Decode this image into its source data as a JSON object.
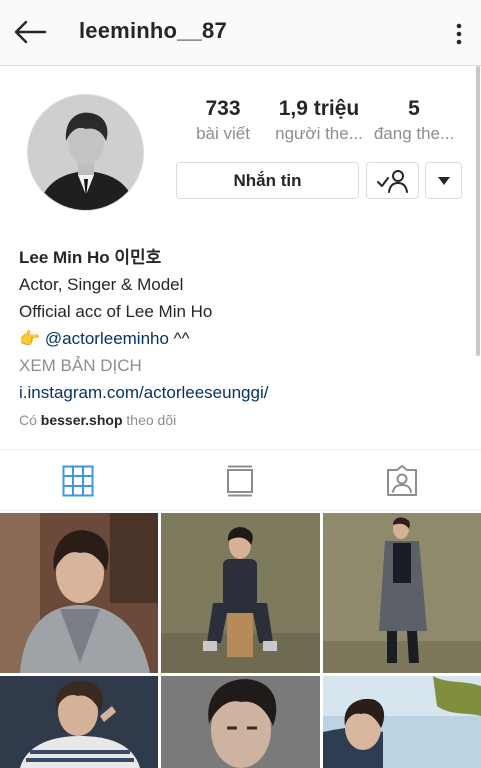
{
  "header": {
    "username": "leeminho__87"
  },
  "profile": {
    "stats": [
      {
        "value": "733",
        "label": "bài viết"
      },
      {
        "value": "1,9 triệu",
        "label": "người the..."
      },
      {
        "value": "5",
        "label": "đang the..."
      }
    ],
    "message_button": "Nhắn tin"
  },
  "bio": {
    "name": "Lee Min Ho 이민호",
    "line1": "Actor, Singer & Model",
    "line2": "Official acc of Lee Min Ho",
    "emoji": "👉",
    "mention": "@actorleeminho",
    "mention_suffix": " ^^",
    "translate": "XEM BẢN DỊCH",
    "link": "i.instagram.com/actorleeseunggi/",
    "followed_prefix": "Có ",
    "followed_by": "besser.shop",
    "followed_suffix": " theo dõi"
  },
  "tabs": [
    {
      "icon": "grid-icon",
      "active": true
    },
    {
      "icon": "feed-icon",
      "active": false
    },
    {
      "icon": "tagged-icon",
      "active": false
    }
  ],
  "colors": {
    "active_tab": "#3897f0",
    "inactive_icon": "#8e8e8e",
    "link": "#003569",
    "muted": "#8e8e8e"
  },
  "posts": [
    {
      "name": "post-1"
    },
    {
      "name": "post-2"
    },
    {
      "name": "post-3"
    },
    {
      "name": "post-4"
    },
    {
      "name": "post-5"
    },
    {
      "name": "post-6"
    }
  ]
}
